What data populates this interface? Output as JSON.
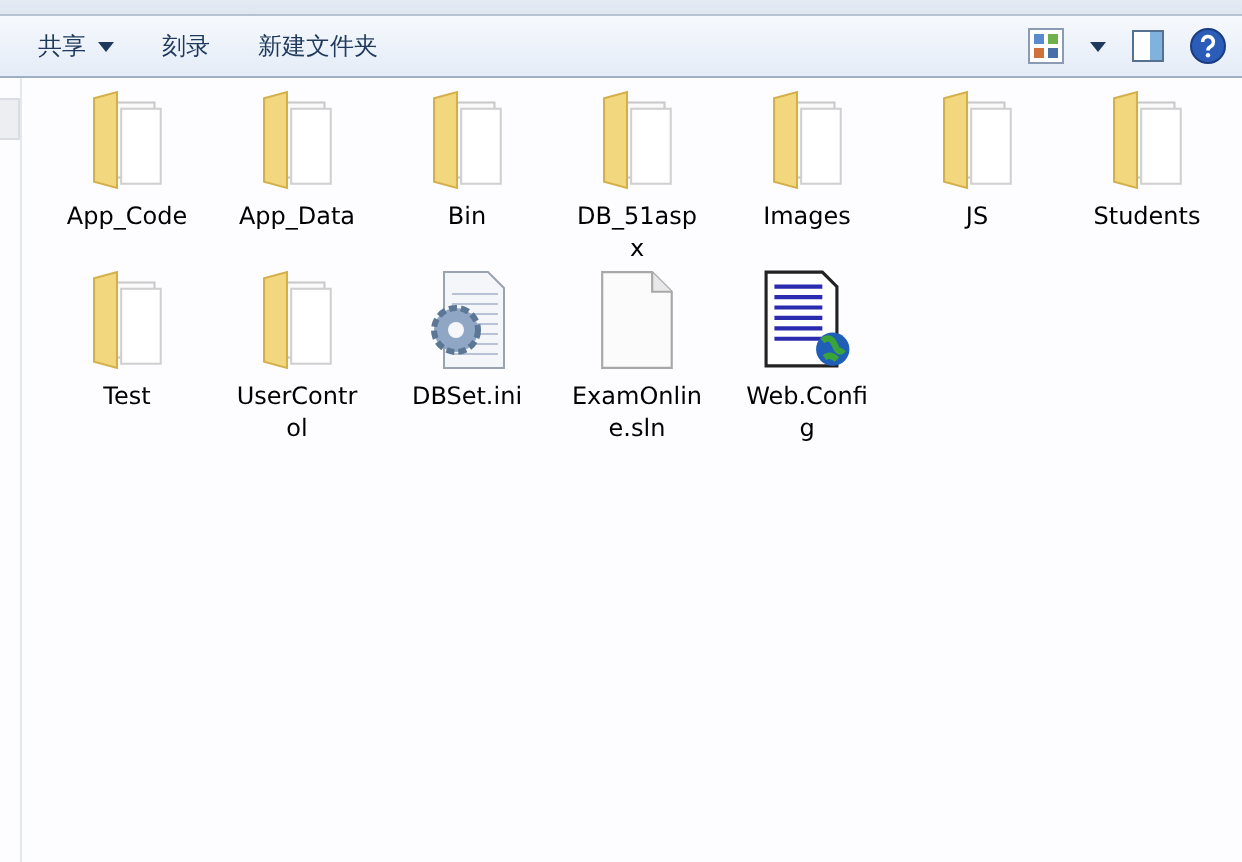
{
  "toolbar": {
    "buttons": [
      {
        "label": "共享",
        "dropdown": true
      },
      {
        "label": "刻录",
        "dropdown": false
      },
      {
        "label": "新建文件夹",
        "dropdown": false
      }
    ]
  },
  "items": [
    {
      "kind": "folder",
      "label": "App_Code"
    },
    {
      "kind": "folder",
      "label": "App_Data"
    },
    {
      "kind": "folder",
      "label": "Bin"
    },
    {
      "kind": "folder",
      "label": "DB_51asp\nx"
    },
    {
      "kind": "folder",
      "label": "Images"
    },
    {
      "kind": "folder",
      "label": "JS"
    },
    {
      "kind": "folder",
      "label": "Students"
    },
    {
      "kind": "folder",
      "label": "Test"
    },
    {
      "kind": "folder",
      "label": "UserContr\nol"
    },
    {
      "kind": "settings-file",
      "label": "DBSet.ini"
    },
    {
      "kind": "blank-file",
      "label": "ExamOnlin\ne.sln"
    },
    {
      "kind": "web-file",
      "label": "Web.Confi\ng"
    }
  ]
}
